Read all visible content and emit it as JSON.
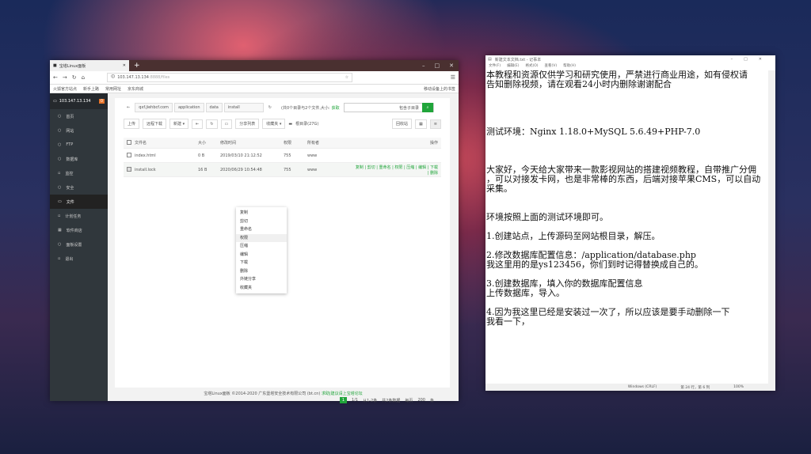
{
  "browser": {
    "tab_title": "宝塔Linux面板",
    "url_host": "103.147.13.134",
    "url_rest": ":8888/files",
    "bookmarks": [
      "火狐官方站点",
      "新手上路",
      "常用网址",
      "京东商城"
    ],
    "bookmarks_right": "移动设备上的书签"
  },
  "sidebar": {
    "host": "103.147.13.134",
    "badge": "0",
    "items": [
      {
        "label": "首页"
      },
      {
        "label": "网站"
      },
      {
        "label": "FTP"
      },
      {
        "label": "数据库"
      },
      {
        "label": "监控"
      },
      {
        "label": "安全"
      },
      {
        "label": "文件"
      },
      {
        "label": "计划任务"
      },
      {
        "label": "软件商店"
      },
      {
        "label": "面板设置"
      },
      {
        "label": "退出"
      }
    ],
    "active": "文件"
  },
  "files": {
    "breadcrumb": [
      "qxf.jiehbcf.com",
      "application",
      "data",
      "install"
    ],
    "summary": "(共0个目录与2个文件,大小:",
    "summary_link": "获取",
    "search_checkbox": "包含子目录",
    "toolbar": [
      "上传",
      "远程下载",
      "新建 ▾",
      "收藏夹 ▾"
    ],
    "share_list": "分享列表",
    "root_dir": "根目录(27G)",
    "recycle": "回收站",
    "columns": [
      "文件名",
      "大小",
      "修改时间",
      "权限",
      "所有者",
      "操作"
    ],
    "rows": [
      {
        "name": "index.html",
        "size": "0 B",
        "time": "2019/03/10 21:12:52",
        "perm": "755",
        "owner": "www",
        "ops": ""
      },
      {
        "name": "install.lock",
        "size": "16 B",
        "time": "2020/06/29 10:54:48",
        "perm": "755",
        "owner": "www",
        "ops": "复制 | 剪切 | 重命名 | 权限 | 压缩 | 编辑 | 下载 | 删除"
      }
    ],
    "context_menu": [
      "复制",
      "剪切",
      "重命名",
      "权限",
      "压缩",
      "编辑",
      "下载",
      "删除",
      "外链分享",
      "收藏夹"
    ],
    "context_hover": "权限",
    "pager": {
      "current": "1",
      "pages": "1/1",
      "range": "从1-2条",
      "total": "共2条数据",
      "per_page_label": "每页",
      "per_page": "200",
      "unit": "条"
    },
    "footer": "宝塔Linux面板 ©2014-2020 广东堡塔安全技术有限公司 (bt.cn)",
    "footer_link": "求助|建议请上宝塔论坛"
  },
  "notepad": {
    "title": "新建文本文档.txt - 记事本",
    "menu": [
      "文件(F)",
      "编辑(E)",
      "格式(O)",
      "查看(V)",
      "帮助(H)"
    ],
    "text": "本教程和资源仅供学习和研究使用，严禁进行商业用途，如有侵权请\n告知删除视频，请在观看24小时内删除谢谢配合\n\n\n\n\n测试环境：Nginx 1.18.0+MySQL 5.6.49+PHP-7.0\n\n\n\n大家好，今天给大家带来一款影视网站的搭建视频教程，自带推广分佣\n，可以对接发卡网，也是非常棒的东西，后端对接苹果CMS，可以自动\n采集。\n\n\n环境按照上面的测试环境即可。\n\n1.创建站点，上传源码至网站根目录，解压。\n\n2.修改数据库配置信息：/application/database.php\n我这里用的是ys123456，你们到时记得替换成自己的。\n\n3.创建数据库，填入你的数据库配置信息\n上传数据库，导入。\n\n4.因为我这里已经是安装过一次了，所以应该是要手动删除一下\n我看一下，",
    "status": [
      "Windows (CRLF)",
      "第 24 行，第 6 列",
      "100%"
    ]
  }
}
